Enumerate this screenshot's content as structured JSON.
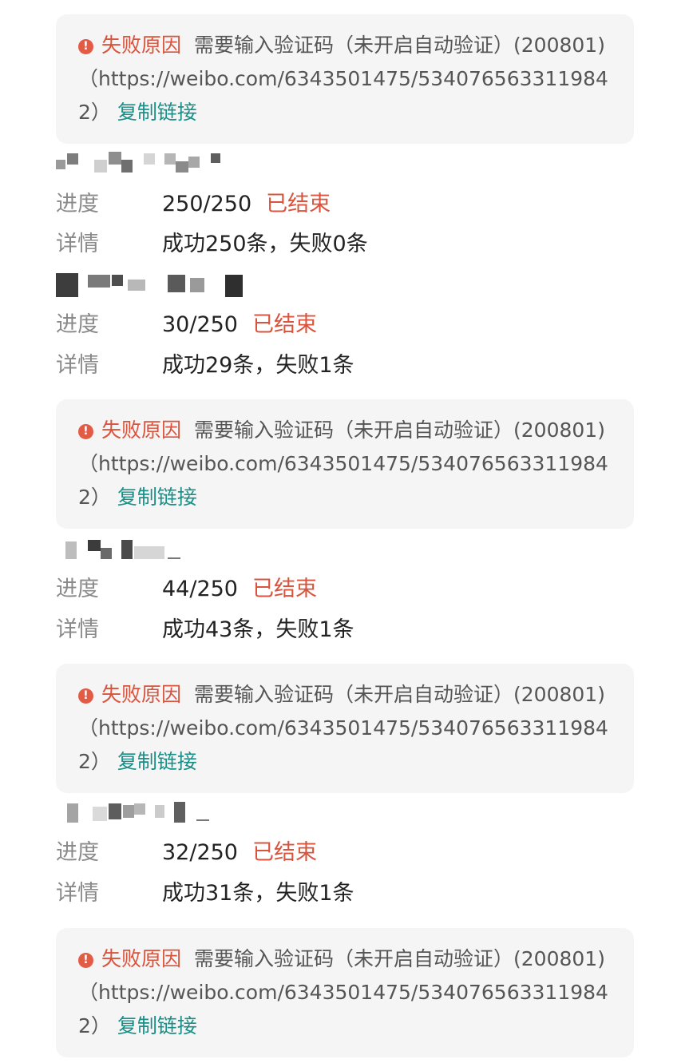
{
  "common": {
    "error_icon": "!",
    "error_label": "失败原因",
    "error_message": "需要输入验证码（未开启自动验证）(200801)（https://weibo.com/6343501475/5340765633119842）",
    "copy_link": "复制链接",
    "progress_label": "进度",
    "detail_label": "详情"
  },
  "tasks": [
    {
      "progress": "250/250",
      "status": "已结束",
      "detail": "成功250条，失败0条"
    },
    {
      "progress": "30/250",
      "status": "已结束",
      "detail": "成功29条，失败1条"
    },
    {
      "progress": "44/250",
      "status": "已结束",
      "detail": "成功43条，失败1条"
    },
    {
      "progress": "32/250",
      "status": "已结束",
      "detail": "成功31条，失败1条"
    }
  ]
}
